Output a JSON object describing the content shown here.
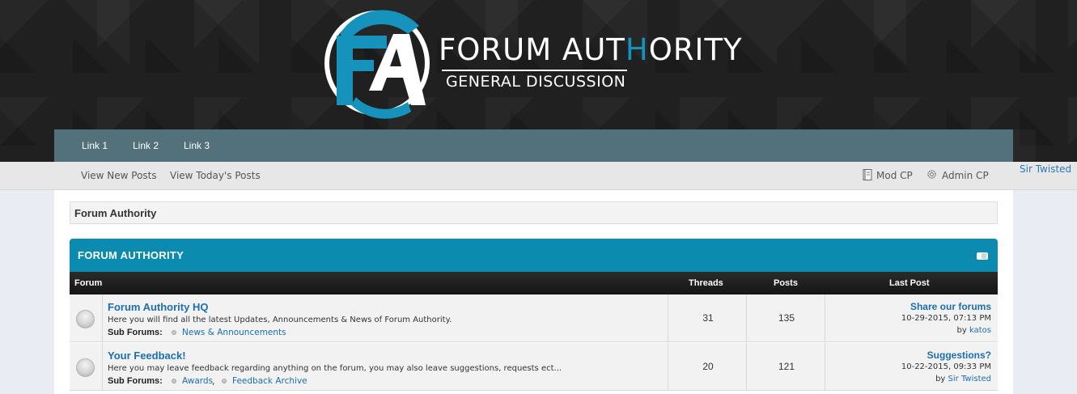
{
  "header": {
    "logo_letters": "FA",
    "title_part1": "FORUM AUT",
    "title_accent": "H",
    "title_part2": "ORITY",
    "subtitle": "GENERAL DISCUSSION",
    "colors": {
      "accent": "#1693bd",
      "background": "#202020"
    }
  },
  "navbar": {
    "links": [
      {
        "label": "Link 1"
      },
      {
        "label": "Link 2"
      },
      {
        "label": "Link 3"
      }
    ]
  },
  "subnav": {
    "view_new_posts": "View New Posts",
    "view_todays_posts": "View Today's Posts",
    "mod_cp": "Mod CP",
    "admin_cp": "Admin CP",
    "user": "Sir Twisted"
  },
  "breadcrumb": {
    "label": "Forum Authority"
  },
  "category": {
    "title": "FORUM AUTHORITY",
    "columns": {
      "forum": "Forum",
      "threads": "Threads",
      "posts": "Posts",
      "last_post": "Last Post"
    },
    "forums": [
      {
        "title": "Forum Authority HQ",
        "description": "Here you will find all the latest Updates, Announcements & News of Forum Authority.",
        "subforums_label": "Sub Forums:",
        "subforums": [
          "News & Announcements"
        ],
        "threads": "31",
        "posts": "135",
        "last_post": {
          "title": "Share our forums",
          "date": "10-29-2015, 07:13 PM",
          "by_label": "by",
          "author": "katos"
        }
      },
      {
        "title": "Your Feedback!",
        "description": "Here you may leave feedback regarding anything on the forum, you may also leave suggestions, requests ect...",
        "subforums_label": "Sub Forums:",
        "subforums": [
          "Awards",
          "Feedback Archive"
        ],
        "threads": "20",
        "posts": "121",
        "last_post": {
          "title": "Suggestions?",
          "date": "10-22-2015, 09:33 PM",
          "by_label": "by",
          "author": "Sir Twisted"
        }
      }
    ]
  }
}
